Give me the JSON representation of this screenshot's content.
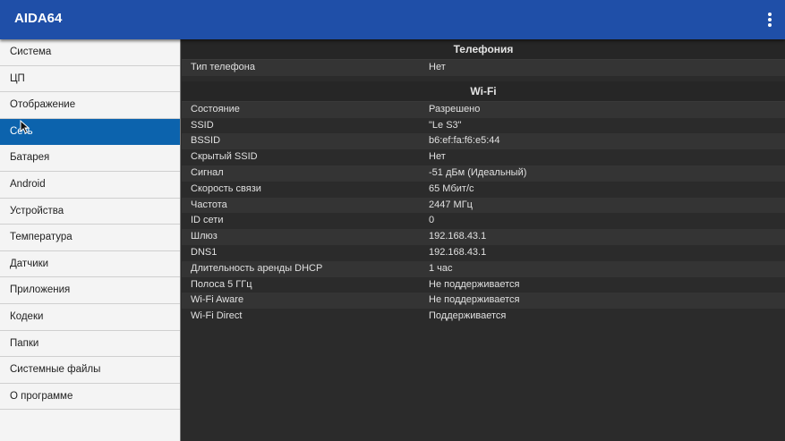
{
  "app": {
    "title": "AIDA64"
  },
  "icons": {
    "menu": "more-vert-icon",
    "cursor": "mouse-cursor-icon"
  },
  "colors": {
    "appbar": "#1f4fa8",
    "selected": "#0c63ad",
    "background": "#2b2b2b"
  },
  "sidebar": {
    "items": [
      {
        "label": "Система"
      },
      {
        "label": "ЦП"
      },
      {
        "label": "Отображение"
      },
      {
        "label": "Сеть",
        "selected": true
      },
      {
        "label": "Батарея"
      },
      {
        "label": "Android"
      },
      {
        "label": "Устройства"
      },
      {
        "label": "Температура"
      },
      {
        "label": "Датчики"
      },
      {
        "label": "Приложения"
      },
      {
        "label": "Кодеки"
      },
      {
        "label": "Папки"
      },
      {
        "label": "Системные файлы"
      },
      {
        "label": "О программе"
      }
    ]
  },
  "content": {
    "telephony": {
      "header": "Телефония",
      "rows": [
        {
          "label": "Тип телефона",
          "value": "Нет"
        }
      ]
    },
    "wifi": {
      "header": "Wi-Fi",
      "rows": [
        {
          "label": "Состояние",
          "value": "Разрешено"
        },
        {
          "label": "SSID",
          "value": "\"Le S3\""
        },
        {
          "label": "BSSID",
          "value": "b6:ef:fa:f6:e5:44"
        },
        {
          "label": "Скрытый SSID",
          "value": "Нет"
        },
        {
          "label": "Сигнал",
          "value": "-51 дБм (Идеальный)"
        },
        {
          "label": "Скорость связи",
          "value": "65 Мбит/с"
        },
        {
          "label": "Частота",
          "value": "2447 МГц"
        },
        {
          "label": "ID сети",
          "value": "0"
        },
        {
          "label": "Шлюз",
          "value": "192.168.43.1"
        },
        {
          "label": "DNS1",
          "value": "192.168.43.1"
        },
        {
          "label": "Длительность аренды DHCP",
          "value": "1 час"
        },
        {
          "label": "Полоса 5 ГГц",
          "value": "Не поддерживается"
        },
        {
          "label": "Wi-Fi Aware",
          "value": "Не поддерживается"
        },
        {
          "label": "Wi-Fi Direct",
          "value": "Поддерживается"
        }
      ]
    }
  }
}
